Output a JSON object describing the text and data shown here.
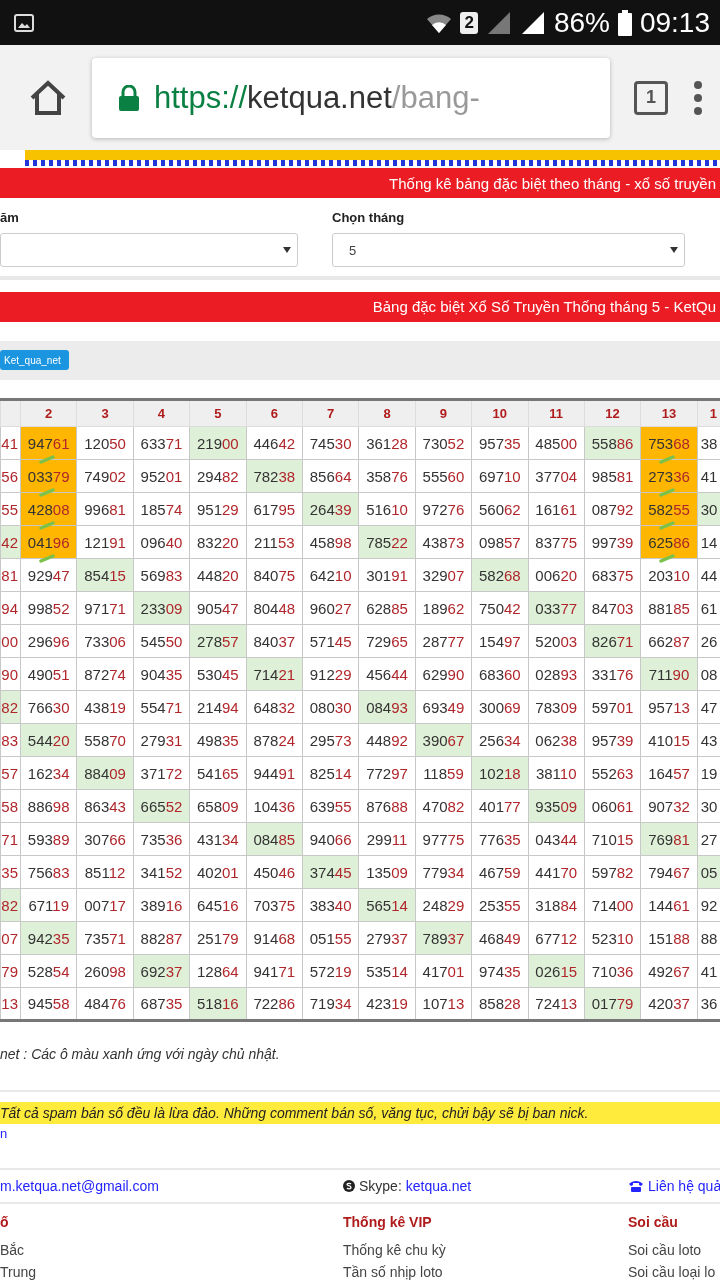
{
  "status_bar": {
    "sim_badge": "2",
    "battery": "86%",
    "time": "09:13"
  },
  "browser": {
    "url": {
      "scheme": "https://",
      "host": "ketqua.net",
      "path": "/bang-"
    },
    "tab_count": "1"
  },
  "filter_bar": {
    "title": "Thống kê bảng đặc biệt theo tháng - xổ số truyền",
    "fields": [
      {
        "label": "ăm"
      },
      {
        "label": "Chọn tháng",
        "value": "5"
      }
    ]
  },
  "table_bar": {
    "title": "Bảng đặc biệt Xổ Số Truyền Thống tháng 5 - KetQu"
  },
  "share": {
    "button": "Ket_qua_net"
  },
  "table": {
    "columns": [
      "",
      "2",
      "3",
      "4",
      "5",
      "6",
      "7",
      "8",
      "9",
      "10",
      "11",
      "12",
      "13",
      "1"
    ],
    "rows": [
      [
        {
          "tail": "41",
          "kind": "plain"
        },
        {
          "head": "947",
          "tail": "61",
          "kind": "streak"
        },
        {
          "head": "120",
          "tail": "50",
          "kind": "plain"
        },
        {
          "head": "633",
          "tail": "71",
          "kind": "plain"
        },
        {
          "head": "219",
          "tail": "00",
          "kind": "sunday"
        },
        {
          "head": "446",
          "tail": "42",
          "kind": "plain"
        },
        {
          "head": "745",
          "tail": "30",
          "kind": "plain"
        },
        {
          "head": "361",
          "tail": "28",
          "kind": "plain"
        },
        {
          "head": "730",
          "tail": "52",
          "kind": "plain"
        },
        {
          "head": "957",
          "tail": "35",
          "kind": "plain"
        },
        {
          "head": "485",
          "tail": "00",
          "kind": "plain"
        },
        {
          "head": "558",
          "tail": "86",
          "kind": "sunday"
        },
        {
          "head": "753",
          "tail": "68",
          "kind": "streak"
        },
        {
          "head": "38",
          "kind": "plain"
        }
      ],
      [
        {
          "tail": "56",
          "kind": "plain"
        },
        {
          "head": "033",
          "tail": "79",
          "kind": "streak"
        },
        {
          "head": "749",
          "tail": "02",
          "kind": "plain"
        },
        {
          "head": "952",
          "tail": "01",
          "kind": "plain"
        },
        {
          "head": "294",
          "tail": "82",
          "kind": "plain"
        },
        {
          "head": "782",
          "tail": "38",
          "kind": "sunday"
        },
        {
          "head": "856",
          "tail": "64",
          "kind": "plain"
        },
        {
          "head": "358",
          "tail": "76",
          "kind": "plain"
        },
        {
          "head": "555",
          "tail": "60",
          "kind": "plain"
        },
        {
          "head": "697",
          "tail": "10",
          "kind": "plain"
        },
        {
          "head": "377",
          "tail": "04",
          "kind": "plain"
        },
        {
          "head": "985",
          "tail": "81",
          "kind": "plain"
        },
        {
          "head": "273",
          "tail": "36",
          "kind": "streak"
        },
        {
          "head": "41",
          "kind": "plain"
        }
      ],
      [
        {
          "tail": "55",
          "kind": "plain"
        },
        {
          "head": "428",
          "tail": "08",
          "kind": "streak"
        },
        {
          "head": "996",
          "tail": "81",
          "kind": "plain"
        },
        {
          "head": "185",
          "tail": "74",
          "kind": "plain"
        },
        {
          "head": "951",
          "tail": "29",
          "kind": "plain"
        },
        {
          "head": "617",
          "tail": "95",
          "kind": "plain"
        },
        {
          "head": "264",
          "tail": "39",
          "kind": "sunday"
        },
        {
          "head": "516",
          "tail": "10",
          "kind": "plain"
        },
        {
          "head": "972",
          "tail": "76",
          "kind": "plain"
        },
        {
          "head": "560",
          "tail": "62",
          "kind": "plain"
        },
        {
          "head": "161",
          "tail": "61",
          "kind": "plain"
        },
        {
          "head": "087",
          "tail": "92",
          "kind": "plain"
        },
        {
          "head": "582",
          "tail": "55",
          "kind": "streak"
        },
        {
          "head": "30",
          "kind": "sunday"
        }
      ],
      [
        {
          "tail": "42",
          "kind": "sunday"
        },
        {
          "head": "041",
          "tail": "96",
          "kind": "streak"
        },
        {
          "head": "121",
          "tail": "91",
          "kind": "plain"
        },
        {
          "head": "096",
          "tail": "40",
          "kind": "plain"
        },
        {
          "head": "832",
          "tail": "20",
          "kind": "plain"
        },
        {
          "head": "211",
          "tail": "53",
          "kind": "plain"
        },
        {
          "head": "458",
          "tail": "98",
          "kind": "plain"
        },
        {
          "head": "785",
          "tail": "22",
          "kind": "sunday"
        },
        {
          "head": "438",
          "tail": "73",
          "kind": "plain"
        },
        {
          "head": "098",
          "tail": "57",
          "kind": "plain"
        },
        {
          "head": "837",
          "tail": "75",
          "kind": "plain"
        },
        {
          "head": "997",
          "tail": "39",
          "kind": "plain"
        },
        {
          "head": "625",
          "tail": "86",
          "kind": "streak"
        },
        {
          "head": "14",
          "kind": "plain"
        }
      ],
      [
        {
          "tail": "81",
          "kind": "plain"
        },
        {
          "head": "929",
          "tail": "47",
          "kind": "plain"
        },
        {
          "head": "854",
          "tail": "15",
          "kind": "sunday"
        },
        {
          "head": "569",
          "tail": "83",
          "kind": "plain"
        },
        {
          "head": "448",
          "tail": "20",
          "kind": "plain"
        },
        {
          "head": "840",
          "tail": "75",
          "kind": "plain"
        },
        {
          "head": "642",
          "tail": "10",
          "kind": "plain"
        },
        {
          "head": "301",
          "tail": "91",
          "kind": "plain"
        },
        {
          "head": "329",
          "tail": "07",
          "kind": "plain"
        },
        {
          "head": "582",
          "tail": "68",
          "kind": "sunday"
        },
        {
          "head": "006",
          "tail": "20",
          "kind": "plain"
        },
        {
          "head": "683",
          "tail": "75",
          "kind": "plain"
        },
        {
          "head": "203",
          "tail": "10",
          "kind": "plain"
        },
        {
          "head": "44",
          "kind": "plain"
        }
      ],
      [
        {
          "tail": "94",
          "kind": "plain"
        },
        {
          "head": "998",
          "tail": "52",
          "kind": "plain"
        },
        {
          "head": "971",
          "tail": "71",
          "kind": "plain"
        },
        {
          "head": "233",
          "tail": "09",
          "kind": "sunday"
        },
        {
          "head": "905",
          "tail": "47",
          "kind": "plain"
        },
        {
          "head": "804",
          "tail": "48",
          "kind": "plain"
        },
        {
          "head": "960",
          "tail": "27",
          "kind": "plain"
        },
        {
          "head": "628",
          "tail": "85",
          "kind": "plain"
        },
        {
          "head": "189",
          "tail": "62",
          "kind": "plain"
        },
        {
          "head": "750",
          "tail": "42",
          "kind": "plain"
        },
        {
          "head": "033",
          "tail": "77",
          "kind": "sunday"
        },
        {
          "head": "847",
          "tail": "03",
          "kind": "plain"
        },
        {
          "head": "881",
          "tail": "85",
          "kind": "plain"
        },
        {
          "head": "61",
          "kind": "plain"
        }
      ],
      [
        {
          "tail": "00",
          "kind": "plain"
        },
        {
          "head": "296",
          "tail": "96",
          "kind": "plain"
        },
        {
          "head": "733",
          "tail": "06",
          "kind": "plain"
        },
        {
          "head": "545",
          "tail": "50",
          "kind": "plain"
        },
        {
          "head": "278",
          "tail": "57",
          "kind": "sunday"
        },
        {
          "head": "840",
          "tail": "37",
          "kind": "plain"
        },
        {
          "head": "571",
          "tail": "45",
          "kind": "plain"
        },
        {
          "head": "729",
          "tail": "65",
          "kind": "plain"
        },
        {
          "head": "287",
          "tail": "77",
          "kind": "plain"
        },
        {
          "head": "154",
          "tail": "97",
          "kind": "plain"
        },
        {
          "head": "520",
          "tail": "03",
          "kind": "plain"
        },
        {
          "head": "826",
          "tail": "71",
          "kind": "sunday"
        },
        {
          "head": "662",
          "tail": "87",
          "kind": "plain"
        },
        {
          "head": "26",
          "kind": "plain"
        }
      ],
      [
        {
          "tail": "90",
          "kind": "plain"
        },
        {
          "head": "490",
          "tail": "51",
          "kind": "plain"
        },
        {
          "head": "872",
          "tail": "74",
          "kind": "plain"
        },
        {
          "head": "904",
          "tail": "35",
          "kind": "plain"
        },
        {
          "head": "530",
          "tail": "45",
          "kind": "plain"
        },
        {
          "head": "714",
          "tail": "21",
          "kind": "sunday"
        },
        {
          "head": "912",
          "tail": "29",
          "kind": "plain"
        },
        {
          "head": "456",
          "tail": "44",
          "kind": "plain"
        },
        {
          "head": "629",
          "tail": "90",
          "kind": "plain"
        },
        {
          "head": "683",
          "tail": "60",
          "kind": "plain"
        },
        {
          "head": "028",
          "tail": "93",
          "kind": "plain"
        },
        {
          "head": "331",
          "tail": "76",
          "kind": "plain"
        },
        {
          "head": "711",
          "tail": "90",
          "kind": "sunday"
        },
        {
          "head": "08",
          "kind": "plain"
        }
      ],
      [
        {
          "tail": "82",
          "kind": "sunday"
        },
        {
          "head": "766",
          "tail": "30",
          "kind": "plain"
        },
        {
          "head": "438",
          "tail": "19",
          "kind": "plain"
        },
        {
          "head": "554",
          "tail": "71",
          "kind": "plain"
        },
        {
          "head": "214",
          "tail": "94",
          "kind": "plain"
        },
        {
          "head": "648",
          "tail": "32",
          "kind": "plain"
        },
        {
          "head": "080",
          "tail": "30",
          "kind": "plain"
        },
        {
          "head": "084",
          "tail": "93",
          "kind": "sunday"
        },
        {
          "head": "693",
          "tail": "49",
          "kind": "plain"
        },
        {
          "head": "300",
          "tail": "69",
          "kind": "plain"
        },
        {
          "head": "783",
          "tail": "09",
          "kind": "plain"
        },
        {
          "head": "597",
          "tail": "01",
          "kind": "plain"
        },
        {
          "head": "957",
          "tail": "13",
          "kind": "plain"
        },
        {
          "head": "47",
          "kind": "plain"
        }
      ],
      [
        {
          "tail": "83",
          "kind": "plain"
        },
        {
          "head": "544",
          "tail": "20",
          "kind": "sunday"
        },
        {
          "head": "558",
          "tail": "70",
          "kind": "plain"
        },
        {
          "head": "279",
          "tail": "31",
          "kind": "plain"
        },
        {
          "head": "498",
          "tail": "35",
          "kind": "plain"
        },
        {
          "head": "878",
          "tail": "24",
          "kind": "plain"
        },
        {
          "head": "295",
          "tail": "73",
          "kind": "plain"
        },
        {
          "head": "448",
          "tail": "92",
          "kind": "plain"
        },
        {
          "head": "390",
          "tail": "67",
          "kind": "sunday"
        },
        {
          "head": "256",
          "tail": "34",
          "kind": "plain"
        },
        {
          "head": "062",
          "tail": "38",
          "kind": "plain"
        },
        {
          "head": "957",
          "tail": "39",
          "kind": "plain"
        },
        {
          "head": "410",
          "tail": "15",
          "kind": "plain"
        },
        {
          "head": "43",
          "kind": "plain"
        }
      ],
      [
        {
          "tail": "57",
          "kind": "plain"
        },
        {
          "head": "162",
          "tail": "34",
          "kind": "plain"
        },
        {
          "head": "884",
          "tail": "09",
          "kind": "sunday"
        },
        {
          "head": "371",
          "tail": "72",
          "kind": "plain"
        },
        {
          "head": "541",
          "tail": "65",
          "kind": "plain"
        },
        {
          "head": "944",
          "tail": "91",
          "kind": "plain"
        },
        {
          "head": "825",
          "tail": "14",
          "kind": "plain"
        },
        {
          "head": "772",
          "tail": "97",
          "kind": "plain"
        },
        {
          "head": "118",
          "tail": "59",
          "kind": "plain"
        },
        {
          "head": "102",
          "tail": "18",
          "kind": "sunday"
        },
        {
          "head": "381",
          "tail": "10",
          "kind": "plain"
        },
        {
          "head": "552",
          "tail": "63",
          "kind": "plain"
        },
        {
          "head": "164",
          "tail": "57",
          "kind": "plain"
        },
        {
          "head": "19",
          "kind": "plain"
        }
      ],
      [
        {
          "tail": "58",
          "kind": "plain"
        },
        {
          "head": "886",
          "tail": "98",
          "kind": "plain"
        },
        {
          "head": "863",
          "tail": "43",
          "kind": "plain"
        },
        {
          "head": "665",
          "tail": "52",
          "kind": "sunday"
        },
        {
          "head": "658",
          "tail": "09",
          "kind": "plain"
        },
        {
          "head": "104",
          "tail": "36",
          "kind": "plain"
        },
        {
          "head": "639",
          "tail": "55",
          "kind": "plain"
        },
        {
          "head": "876",
          "tail": "88",
          "kind": "plain"
        },
        {
          "head": "470",
          "tail": "82",
          "kind": "plain"
        },
        {
          "head": "401",
          "tail": "77",
          "kind": "plain"
        },
        {
          "head": "935",
          "tail": "09",
          "kind": "sunday"
        },
        {
          "head": "060",
          "tail": "61",
          "kind": "plain"
        },
        {
          "head": "907",
          "tail": "32",
          "kind": "plain"
        },
        {
          "head": "30",
          "kind": "plain"
        }
      ],
      [
        {
          "tail": "71",
          "kind": "plain"
        },
        {
          "head": "593",
          "tail": "89",
          "kind": "plain"
        },
        {
          "head": "307",
          "tail": "66",
          "kind": "plain"
        },
        {
          "head": "735",
          "tail": "36",
          "kind": "plain"
        },
        {
          "head": "431",
          "tail": "34",
          "kind": "plain"
        },
        {
          "head": "084",
          "tail": "85",
          "kind": "sunday"
        },
        {
          "head": "940",
          "tail": "66",
          "kind": "plain"
        },
        {
          "head": "299",
          "tail": "11",
          "kind": "plain"
        },
        {
          "head": "977",
          "tail": "75",
          "kind": "plain"
        },
        {
          "head": "776",
          "tail": "35",
          "kind": "plain"
        },
        {
          "head": "043",
          "tail": "44",
          "kind": "plain"
        },
        {
          "head": "710",
          "tail": "15",
          "kind": "plain"
        },
        {
          "head": "769",
          "tail": "81",
          "kind": "sunday"
        },
        {
          "head": "27",
          "kind": "plain"
        }
      ],
      [
        {
          "tail": "35",
          "kind": "plain"
        },
        {
          "head": "756",
          "tail": "83",
          "kind": "plain"
        },
        {
          "head": "851",
          "tail": "12",
          "kind": "plain"
        },
        {
          "head": "341",
          "tail": "52",
          "kind": "plain"
        },
        {
          "head": "402",
          "tail": "01",
          "kind": "plain"
        },
        {
          "head": "450",
          "tail": "46",
          "kind": "plain"
        },
        {
          "head": "374",
          "tail": "45",
          "kind": "sunday"
        },
        {
          "head": "135",
          "tail": "09",
          "kind": "plain"
        },
        {
          "head": "779",
          "tail": "34",
          "kind": "plain"
        },
        {
          "head": "467",
          "tail": "59",
          "kind": "plain"
        },
        {
          "head": "441",
          "tail": "70",
          "kind": "plain"
        },
        {
          "head": "597",
          "tail": "82",
          "kind": "plain"
        },
        {
          "head": "794",
          "tail": "67",
          "kind": "plain"
        },
        {
          "head": "05",
          "kind": "sunday"
        }
      ],
      [
        {
          "tail": "82",
          "kind": "sunday"
        },
        {
          "head": "671",
          "tail": "19",
          "kind": "plain"
        },
        {
          "head": "007",
          "tail": "17",
          "kind": "plain"
        },
        {
          "head": "389",
          "tail": "16",
          "kind": "plain"
        },
        {
          "head": "645",
          "tail": "16",
          "kind": "plain"
        },
        {
          "head": "703",
          "tail": "75",
          "kind": "plain"
        },
        {
          "head": "383",
          "tail": "40",
          "kind": "plain"
        },
        {
          "head": "565",
          "tail": "14",
          "kind": "sunday"
        },
        {
          "head": "248",
          "tail": "29",
          "kind": "plain"
        },
        {
          "head": "253",
          "tail": "55",
          "kind": "plain"
        },
        {
          "head": "318",
          "tail": "84",
          "kind": "plain"
        },
        {
          "head": "714",
          "tail": "00",
          "kind": "plain"
        },
        {
          "head": "144",
          "tail": "61",
          "kind": "plain"
        },
        {
          "head": "92",
          "kind": "plain"
        }
      ],
      [
        {
          "tail": "07",
          "kind": "plain"
        },
        {
          "head": "942",
          "tail": "35",
          "kind": "sunday"
        },
        {
          "head": "735",
          "tail": "71",
          "kind": "plain"
        },
        {
          "head": "882",
          "tail": "87",
          "kind": "plain"
        },
        {
          "head": "251",
          "tail": "79",
          "kind": "plain"
        },
        {
          "head": "914",
          "tail": "68",
          "kind": "plain"
        },
        {
          "head": "051",
          "tail": "55",
          "kind": "plain"
        },
        {
          "head": "279",
          "tail": "37",
          "kind": "plain"
        },
        {
          "head": "789",
          "tail": "37",
          "kind": "sunday"
        },
        {
          "head": "468",
          "tail": "49",
          "kind": "plain"
        },
        {
          "head": "677",
          "tail": "12",
          "kind": "plain"
        },
        {
          "head": "523",
          "tail": "10",
          "kind": "plain"
        },
        {
          "head": "151",
          "tail": "88",
          "kind": "plain"
        },
        {
          "head": "88",
          "kind": "plain"
        }
      ],
      [
        {
          "tail": "79",
          "kind": "plain"
        },
        {
          "head": "528",
          "tail": "54",
          "kind": "plain"
        },
        {
          "head": "260",
          "tail": "98",
          "kind": "plain"
        },
        {
          "head": "692",
          "tail": "37",
          "kind": "sunday"
        },
        {
          "head": "128",
          "tail": "64",
          "kind": "plain"
        },
        {
          "head": "941",
          "tail": "71",
          "kind": "plain"
        },
        {
          "head": "572",
          "tail": "19",
          "kind": "plain"
        },
        {
          "head": "535",
          "tail": "14",
          "kind": "plain"
        },
        {
          "head": "417",
          "tail": "01",
          "kind": "plain"
        },
        {
          "head": "974",
          "tail": "35",
          "kind": "plain"
        },
        {
          "head": "026",
          "tail": "15",
          "kind": "sunday"
        },
        {
          "head": "710",
          "tail": "36",
          "kind": "plain"
        },
        {
          "head": "492",
          "tail": "67",
          "kind": "plain"
        },
        {
          "head": "41",
          "kind": "plain"
        }
      ],
      [
        {
          "tail": "13",
          "kind": "plain"
        },
        {
          "head": "945",
          "tail": "58",
          "kind": "plain"
        },
        {
          "head": "484",
          "tail": "76",
          "kind": "plain"
        },
        {
          "head": "687",
          "tail": "35",
          "kind": "plain"
        },
        {
          "head": "518",
          "tail": "16",
          "kind": "sunday"
        },
        {
          "head": "722",
          "tail": "86",
          "kind": "plain"
        },
        {
          "head": "719",
          "tail": "34",
          "kind": "plain"
        },
        {
          "head": "423",
          "tail": "19",
          "kind": "plain"
        },
        {
          "head": "107",
          "tail": "13",
          "kind": "plain"
        },
        {
          "head": "858",
          "tail": "28",
          "kind": "plain"
        },
        {
          "head": "724",
          "tail": "13",
          "kind": "plain"
        },
        {
          "head": "017",
          "tail": "79",
          "kind": "sunday"
        },
        {
          "head": "420",
          "tail": "37",
          "kind": "plain"
        },
        {
          "head": "36",
          "kind": "plain"
        }
      ]
    ]
  },
  "note": "net : Các ô màu xanh ứng với ngày chủ nhật.",
  "warning": "Tất cả spam bán số đều là lừa đảo. Những comment bán số, văng tục, chửi bậy sẽ bị ban nick.",
  "warning_link": "n",
  "contacts": {
    "email": "m.ketqua.net@gmail.com",
    "skype_label": "Skype: ",
    "skype": "ketqua.net",
    "phone": "Liên hệ quả"
  },
  "footer_columns": [
    {
      "title": "ố",
      "links": [
        "Bắc",
        "Trung"
      ]
    },
    {
      "title": "Thống kê VIP",
      "links": [
        "Thống kê chu kỳ",
        "Tần số nhịp loto"
      ]
    },
    {
      "title": "Soi cầu",
      "links": [
        "Soi cầu loto",
        "Soi cầu loại lo"
      ]
    }
  ]
}
